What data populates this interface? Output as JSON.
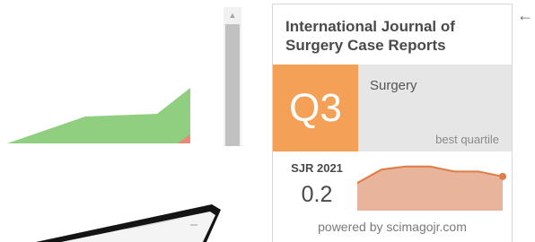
{
  "widget": {
    "title_line1": "International Journal of",
    "title_line2": "Surgery Case Reports",
    "quartile": "Q3",
    "category": "Surgery",
    "quartile_caption": "best quartile",
    "sjr_label": "SJR 2021",
    "sjr_value": "0.2",
    "powered_by": "powered by scimagojr.com",
    "colors": {
      "quartile_orange": "#f4a056",
      "quartile_bg": "#e6e6e6",
      "trend_fill": "#e8b59c",
      "trend_line": "#e07b45"
    },
    "sjr_trend_relative": [
      0.55,
      0.82,
      0.88,
      0.88,
      0.78,
      0.78,
      0.68
    ]
  },
  "background_chart": {
    "colors": {
      "green_area": "#8fcf7f",
      "red_area": "#e8877a"
    }
  },
  "icons": {
    "scroll_up": "scroll-up-arrow-icon",
    "back": "back-arrow-icon"
  },
  "glyphs": {
    "scroll_up": "▲",
    "back": "←"
  }
}
